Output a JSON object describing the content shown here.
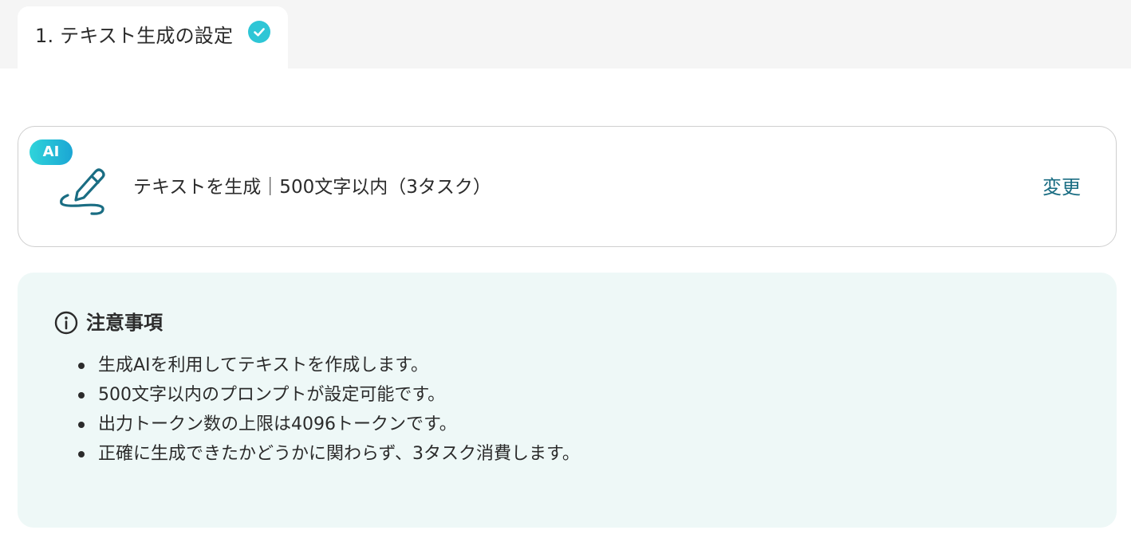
{
  "tab": {
    "label": "1. テキスト生成の設定",
    "status_icon": "check-circle-icon",
    "status_color": "#2ec6d6"
  },
  "operation": {
    "badge": "AI",
    "icon": "pen-signature-icon",
    "title": "テキストを生成｜500文字以内（3タスク）",
    "change_label": "変更",
    "accent_color": "#1a6d83"
  },
  "notice": {
    "icon": "info-icon",
    "title": "注意事項",
    "items": [
      "生成AIを利用してテキストを作成します。",
      "500文字以内のプロンプトが設定可能です。",
      "出力トークン数の上限は4096トークンです。",
      "正確に生成できたかどうかに関わらず、3タスク消費します。"
    ],
    "background": "#eef8f7"
  }
}
